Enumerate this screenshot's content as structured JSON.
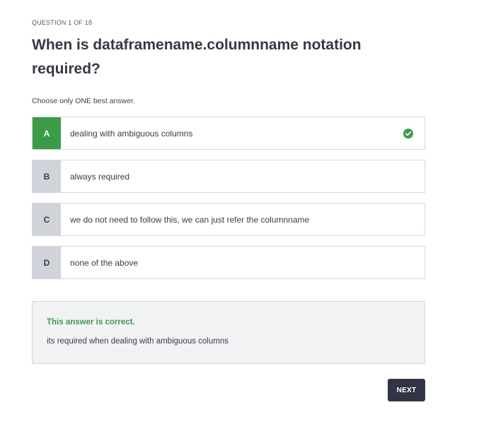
{
  "quiz": {
    "counter": "QUESTION 1 OF 18",
    "question": "When is dataframename.columnname notation required?",
    "instruction": "Choose only ONE best answer.",
    "options": [
      {
        "letter": "A",
        "text": "dealing with ambiguous columns",
        "state": "correct"
      },
      {
        "letter": "B",
        "text": "always required",
        "state": "default"
      },
      {
        "letter": "C",
        "text": "we do not need to follow this, we can just refer the columnname",
        "state": "default"
      },
      {
        "letter": "D",
        "text": "none of the above",
        "state": "default"
      }
    ],
    "feedback": {
      "title": "This answer is correct.",
      "body": "its required when dealing with ambiguous columns"
    },
    "next_label": "NEXT"
  },
  "colors": {
    "correct_green": "#3a9b48",
    "letter_gray": "#d0d3da",
    "button_dark": "#323446",
    "feedback_bg": "#f1f2f4"
  },
  "icons": {
    "correct_option": "check-circle-icon"
  }
}
